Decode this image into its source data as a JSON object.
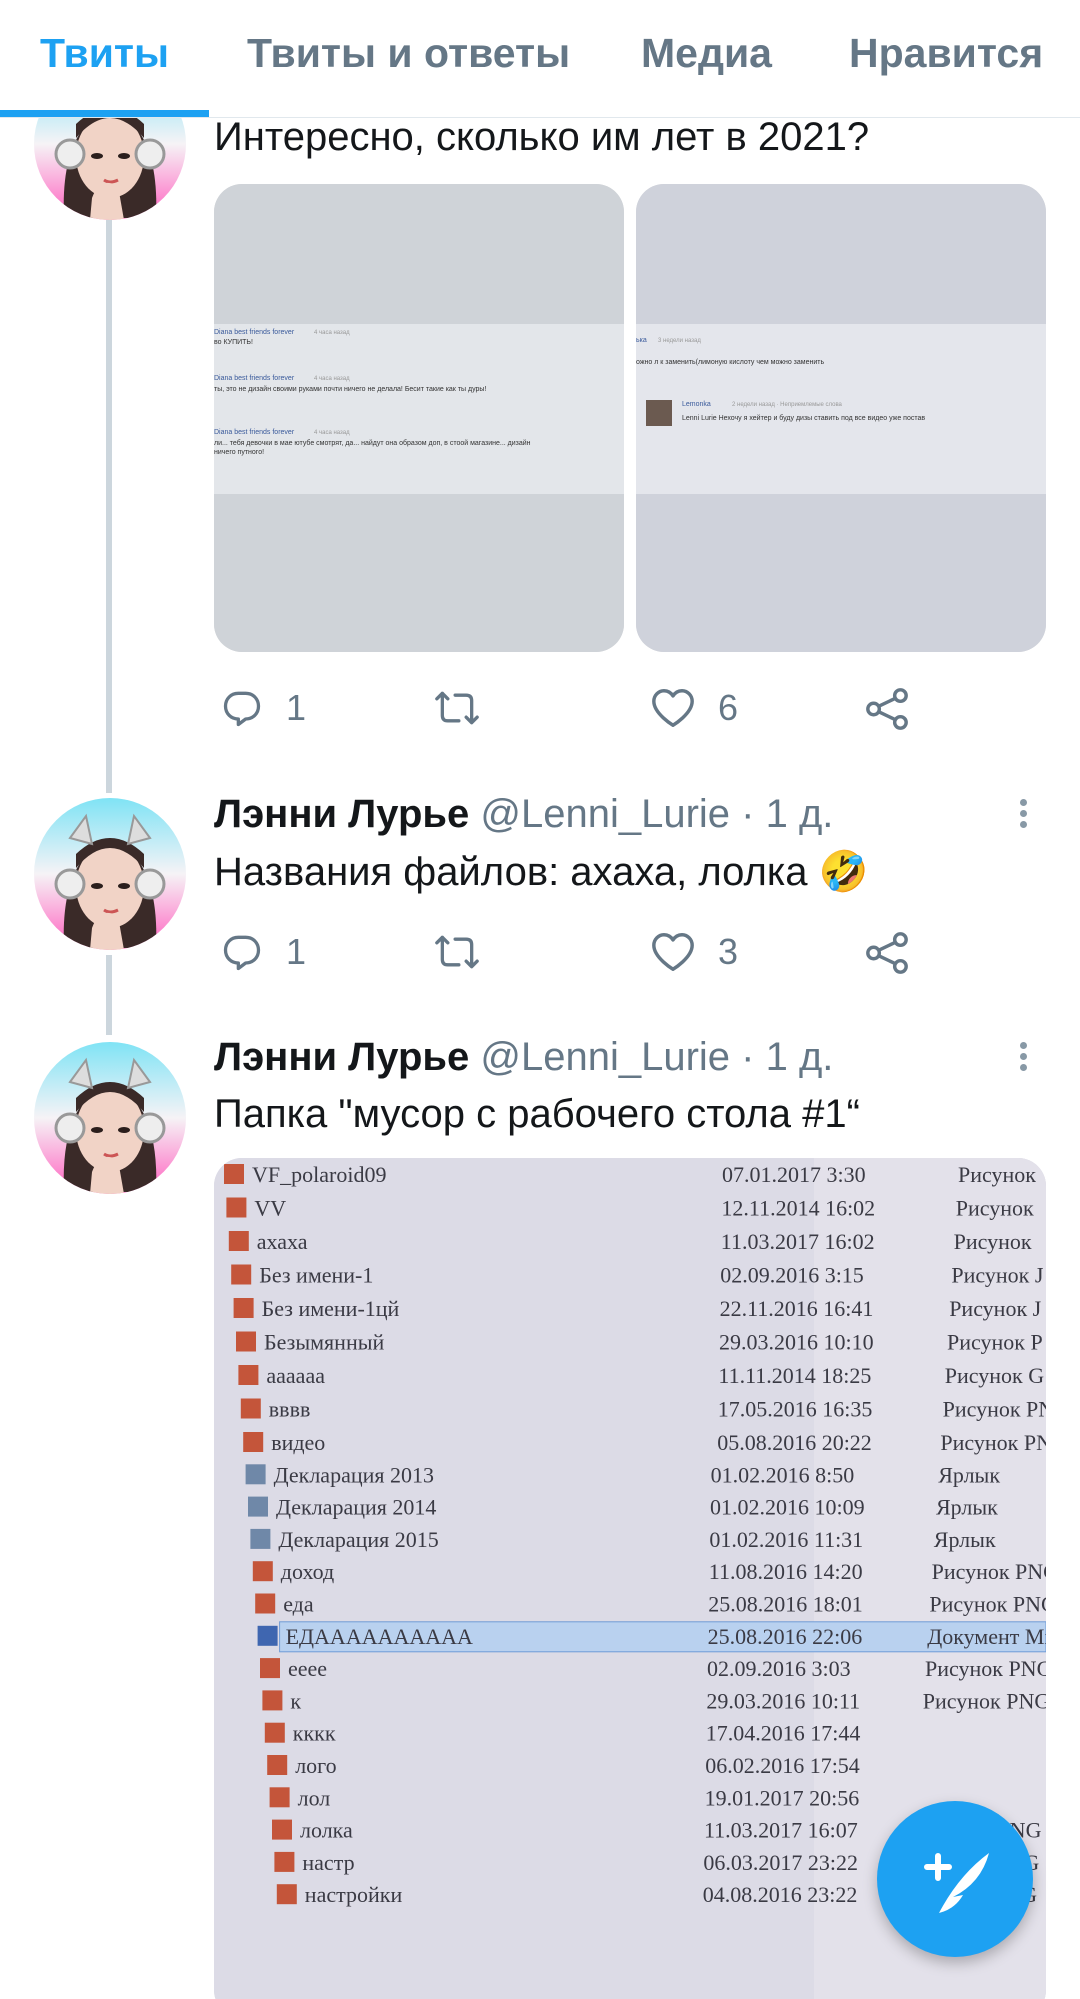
{
  "tabs": [
    {
      "label": "Твиты",
      "active": true
    },
    {
      "label": "Твиты и ответы",
      "active": false
    },
    {
      "label": "Медиа",
      "active": false
    },
    {
      "label": "Нравится",
      "active": false
    }
  ],
  "tweets": [
    {
      "text": "Интересно, сколько им лет в 2021?",
      "photo_left": {
        "comments": [
          {
            "author": "Diana best friends forever",
            "time": "4 часа назад",
            "text": "во КУПИТЬ!"
          },
          {
            "author": "Diana best friends forever",
            "time": "4 часа назад",
            "text": "ты, это не дизайн своими руками почти ничего не делала! Бесит такие как ты дуры!"
          },
          {
            "author": "Diana best friends forever",
            "time": "4 часа назад",
            "text": "ли... тебя девочки в мае ютубе смотрят, да... найдут она образом доп, в стоой магазине... дизайн"
          },
          {
            "author": "",
            "time": "",
            "text": "ничего путного!"
          }
        ]
      },
      "photo_right": {
        "comments": [
          {
            "author": "ька",
            "time": "3 недели назад",
            "text": "ожно л к заменить(лимоную кислоту чем можно заменить"
          },
          {
            "author": "Lemonka",
            "time": "2 недели назад · Неприемлемые слова",
            "text": "Lenni Lurie Нехочу я хейтер и буду дизы ставить под все видео уже постав"
          }
        ]
      },
      "replies": "1",
      "likes": "6"
    },
    {
      "name": "Лэнни Лурье",
      "handle": "@Lenni_Lurie",
      "time": "· 1 д.",
      "text": "Названия файлов: ахаха, лолка 🤣",
      "replies": "1",
      "likes": "3"
    },
    {
      "name": "Лэнни Лурье",
      "handle": "@Lenni_Lurie",
      "time": "· 1 д.",
      "text": "Папка \"мусор с рабочего стола #1“",
      "files": [
        {
          "name": "VF_polaroid09",
          "date": "07.01.2017 3:30",
          "type": "Рисунок"
        },
        {
          "name": "VV",
          "date": "12.11.2014 16:02",
          "type": "Рисунок"
        },
        {
          "name": "ахаха",
          "date": "11.03.2017 16:02",
          "type": "Рисунок"
        },
        {
          "name": "Без имени-1",
          "date": "02.09.2016 3:15",
          "type": "Рисунок J"
        },
        {
          "name": "Без имени-1цй",
          "date": "22.11.2016 16:41",
          "type": "Рисунок J"
        },
        {
          "name": "Безымянный",
          "date": "29.03.2016 10:10",
          "type": "Рисунок P"
        },
        {
          "name": "аааааа",
          "date": "11.11.2014 18:25",
          "type": "Рисунок G"
        },
        {
          "name": "вввв",
          "date": "17.05.2016 16:35",
          "type": "Рисунок PN"
        },
        {
          "name": "видео",
          "date": "05.08.2016 20:22",
          "type": "Рисунок PN"
        },
        {
          "name": "Декларация 2013",
          "date": "01.02.2016 8:50",
          "type": "Ярлык"
        },
        {
          "name": "Декларация 2014",
          "date": "01.02.2016 10:09",
          "type": "Ярлык"
        },
        {
          "name": "Декларация 2015",
          "date": "01.02.2016 11:31",
          "type": "Ярлык"
        },
        {
          "name": "доход",
          "date": "11.08.2016 14:20",
          "type": "Рисунок PNG"
        },
        {
          "name": "еда",
          "date": "25.08.2016 18:01",
          "type": "Рисунок PNG"
        },
        {
          "name": "ЕДАААААААААА",
          "date": "25.08.2016 22:06",
          "type": "Документ Mic",
          "selected": true
        },
        {
          "name": "eeee",
          "date": "02.09.2016 3:03",
          "type": "Рисунок PNG"
        },
        {
          "name": "к",
          "date": "29.03.2016 10:11",
          "type": "Рисунок PNG"
        },
        {
          "name": "кккк",
          "date": "17.04.2016 17:44",
          "type": ""
        },
        {
          "name": "лого",
          "date": "06.02.2016 17:54",
          "type": ""
        },
        {
          "name": "лол",
          "date": "19.01.2017 20:56",
          "type": ""
        },
        {
          "name": "лолка",
          "date": "11.03.2017 16:07",
          "type": "Рисунок PNG"
        },
        {
          "name": "настр",
          "date": "06.03.2017 23:22",
          "type": "Рисунок PNG"
        },
        {
          "name": "настройки",
          "date": "04.08.2016 23:22",
          "type": "Рисунок PNG"
        }
      ]
    }
  ],
  "colors": {
    "accent": "#1da1f2",
    "muted": "#657786",
    "thread": "#ccd6dd"
  },
  "icons": {
    "reply": "reply-icon",
    "retweet": "retweet-icon",
    "like": "heart-icon",
    "share": "share-icon",
    "compose": "compose-tweet-icon",
    "more": "more-vertical-icon"
  }
}
